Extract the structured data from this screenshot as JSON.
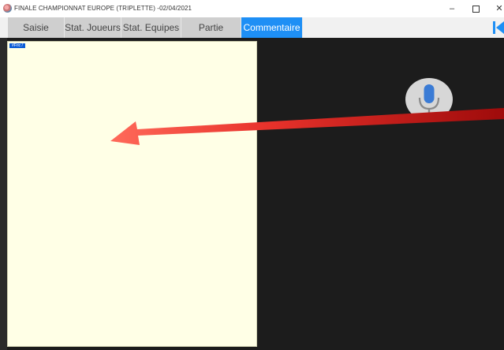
{
  "window": {
    "title": "FINALE CHAMPIONNAT EUROPE (TRIPLETTE) -02/04/2021",
    "minimize_glyph": "–",
    "close_glyph": "✕"
  },
  "tabs": [
    {
      "label": "Saisie",
      "active": false
    },
    {
      "label": "Stat. Joueurs",
      "active": false
    },
    {
      "label": "Stat. Equipes",
      "active": false
    },
    {
      "label": "Partie",
      "active": false
    },
    {
      "label": "Commentaire",
      "active": true
    }
  ],
  "comment": {
    "tag": "#Fric /"
  },
  "icons": {
    "back": "skip-back-icon",
    "mic": "microphone-icon",
    "arrow": "red-arrow-annotation"
  },
  "colors": {
    "active_tab": "#1e8ff5",
    "panel_bg": "#ffffe6",
    "dark_bg": "#1c1c1c",
    "arrow": "#e8322b",
    "mic_blue": "#3a7bd5"
  }
}
